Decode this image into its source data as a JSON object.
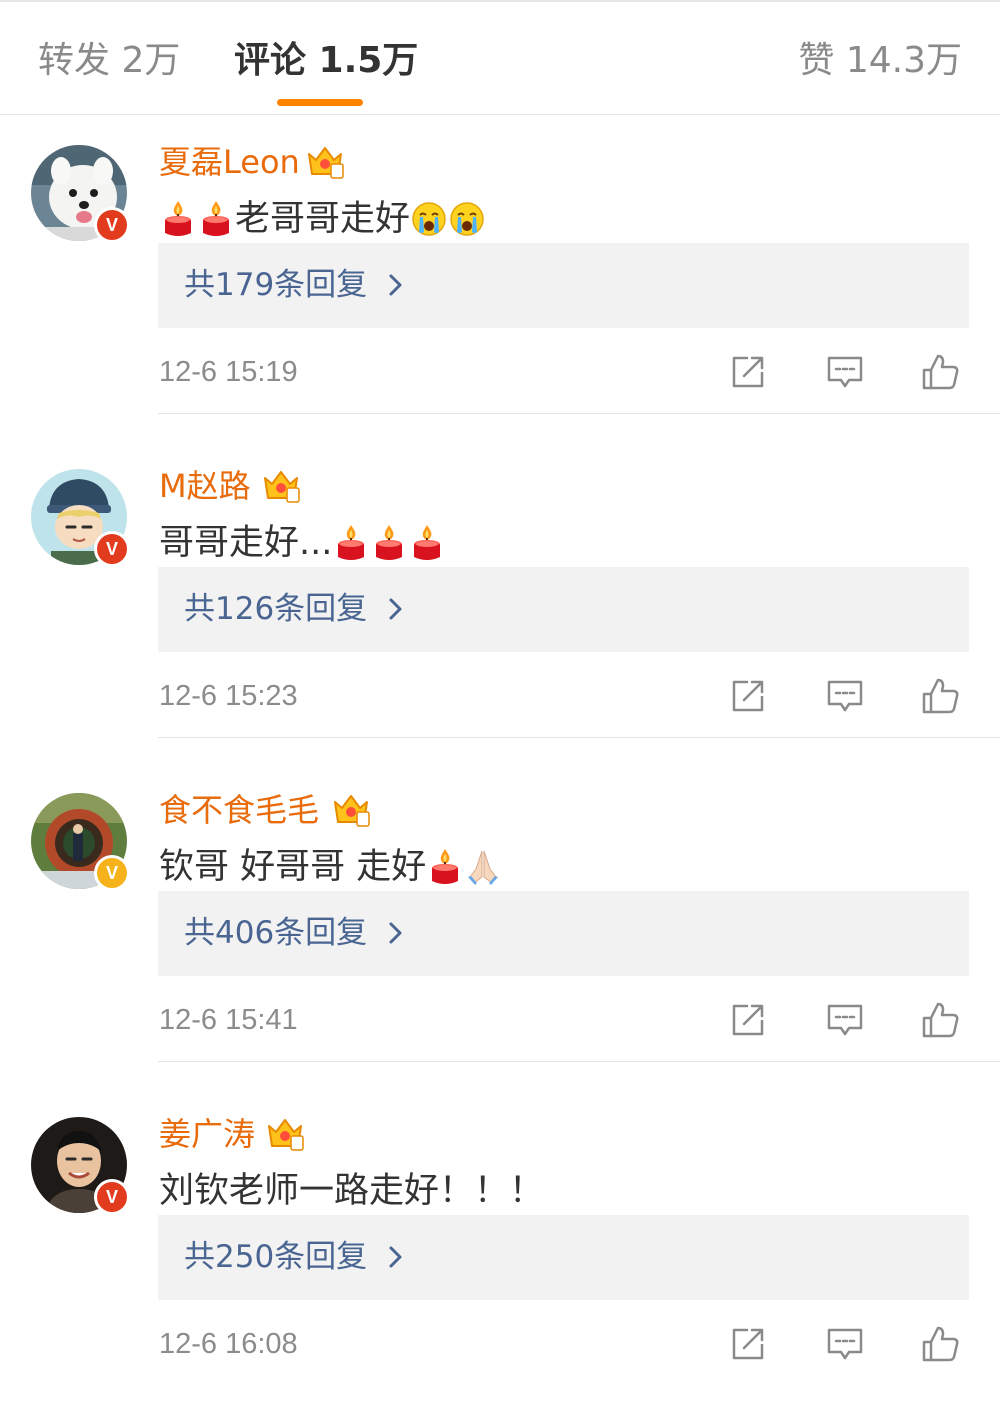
{
  "tabs": {
    "repost": "转发 2万",
    "comments": "评论 1.5万",
    "likes": "赞 14.3万",
    "accent_color": "#ff8200"
  },
  "comments": [
    {
      "username": "夏磊Leon",
      "level_badge": "crown-level-6-icon",
      "verified": "red-v-badge",
      "badge_letter": "V",
      "text": "老哥哥走好",
      "emojis_before": [
        "candle",
        "candle"
      ],
      "emojis_after": [
        "crying-face",
        "crying-face"
      ],
      "replies": "共179条回复",
      "time": "12-6 15:19"
    },
    {
      "username": "M赵路",
      "level_badge": "crown-level-6-icon",
      "verified": "red-v-badge",
      "badge_letter": "V",
      "text": "哥哥走好...",
      "emojis_before": [],
      "emojis_after": [
        "candle",
        "candle",
        "candle"
      ],
      "replies": "共126条回复",
      "time": "12-6 15:23"
    },
    {
      "username": "食不食毛毛",
      "level_badge": "crown-level-7-icon",
      "verified": "gold-v-badge",
      "badge_letter": "V",
      "text": "钦哥 好哥哥 走好",
      "emojis_before": [],
      "emojis_after": [
        "candle",
        "praying-hands"
      ],
      "replies": "共406条回复",
      "time": "12-6 15:41"
    },
    {
      "username": "姜广涛",
      "level_badge": "crown-level-6-icon",
      "verified": "red-v-badge",
      "badge_letter": "V",
      "text": "刘钦老师一路走好！！！",
      "emojis_before": [],
      "emojis_after": [],
      "replies": "共250条回复",
      "time": "12-6 16:08"
    }
  ],
  "colors": {
    "username": "#e86b0c",
    "reply_link": "#4a6591",
    "muted": "#8c8c8c"
  }
}
